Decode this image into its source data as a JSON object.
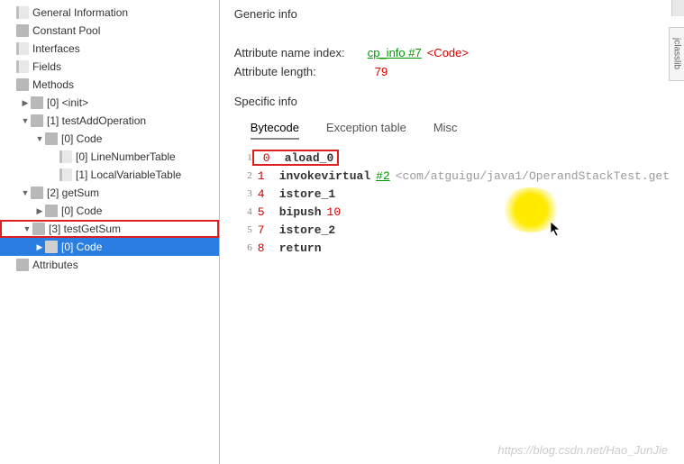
{
  "tree": {
    "general_information": "General Information",
    "constant_pool": "Constant Pool",
    "interfaces": "Interfaces",
    "fields": "Fields",
    "methods": "Methods",
    "init": "[0] <init>",
    "testAddOperation": "[1] testAddOperation",
    "tao_code": "[0] Code",
    "tao_lnt": "[0] LineNumberTable",
    "tao_lvt": "[1] LocalVariableTable",
    "getSum": "[2] getSum",
    "gs_code": "[0] Code",
    "testGetSum": "[3] testGetSum",
    "tgs_code": "[0] Code",
    "attributes": "Attributes"
  },
  "generic": {
    "title": "Generic info",
    "attr_name_label": "Attribute name index:",
    "cp_info": "cp_info #7",
    "code_tag": "<Code>",
    "attr_len_label": "Attribute length:",
    "attr_len_value": "79"
  },
  "specific": {
    "title": "Specific info"
  },
  "tabs": {
    "bytecode": "Bytecode",
    "exception": "Exception table",
    "misc": "Misc"
  },
  "bytecode": [
    {
      "line": "1",
      "offset": "0",
      "instr": "aload_0",
      "arg": "",
      "argType": "",
      "boxed": true
    },
    {
      "line": "2",
      "offset": "1",
      "instr": "invokevirtual",
      "arg": "#2",
      "argType": "green",
      "trail": "<com/atguigu/java1/OperandStackTest.get"
    },
    {
      "line": "3",
      "offset": "4",
      "instr": "istore_1",
      "arg": "",
      "argType": ""
    },
    {
      "line": "4",
      "offset": "5",
      "instr": "bipush",
      "arg": "10",
      "argType": "red"
    },
    {
      "line": "5",
      "offset": "7",
      "instr": "istore_2",
      "arg": "",
      "argType": ""
    },
    {
      "line": "6",
      "offset": "8",
      "instr": "return",
      "arg": "",
      "argType": ""
    }
  ],
  "watermark": "https://blog.csdn.net/Hao_JunJie",
  "right_tab": "jclasslib"
}
